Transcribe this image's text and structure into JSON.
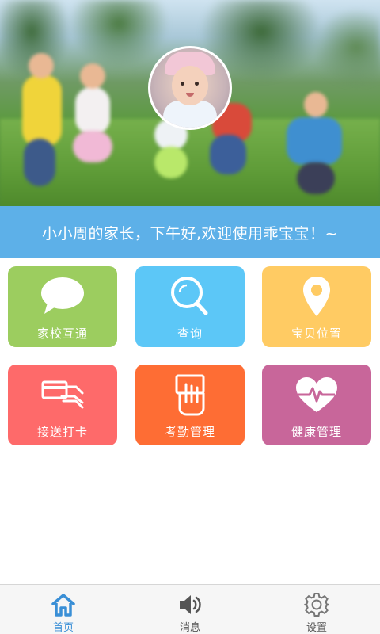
{
  "header": {
    "photo_icon": "children-running-photo",
    "avatar_icon": "child-avatar"
  },
  "banner": {
    "welcome_text": "小小周的家长，下午好,欢迎使用乖宝宝！~"
  },
  "tiles": [
    {
      "label": "家校互通",
      "icon": "chat-bubble-icon",
      "color": "#9ccd5f"
    },
    {
      "label": "查询",
      "icon": "search-icon",
      "color": "#5cc7f7"
    },
    {
      "label": "宝贝位置",
      "icon": "location-pin-icon",
      "color": "#ffcb63"
    },
    {
      "label": "接送打卡",
      "icon": "card-hand-icon",
      "color": "#fe6a6a"
    },
    {
      "label": "考勤管理",
      "icon": "attendance-hand-icon",
      "color": "#fe6d34"
    },
    {
      "label": "健康管理",
      "icon": "heartbeat-icon",
      "color": "#c8669a"
    }
  ],
  "nav": {
    "items": [
      {
        "label": "首页",
        "icon": "home-icon",
        "active": true
      },
      {
        "label": "消息",
        "icon": "speaker-icon",
        "active": false
      },
      {
        "label": "设置",
        "icon": "gear-icon",
        "active": false
      }
    ],
    "active_color": "#3a8fd6",
    "inactive_color": "#555555"
  }
}
